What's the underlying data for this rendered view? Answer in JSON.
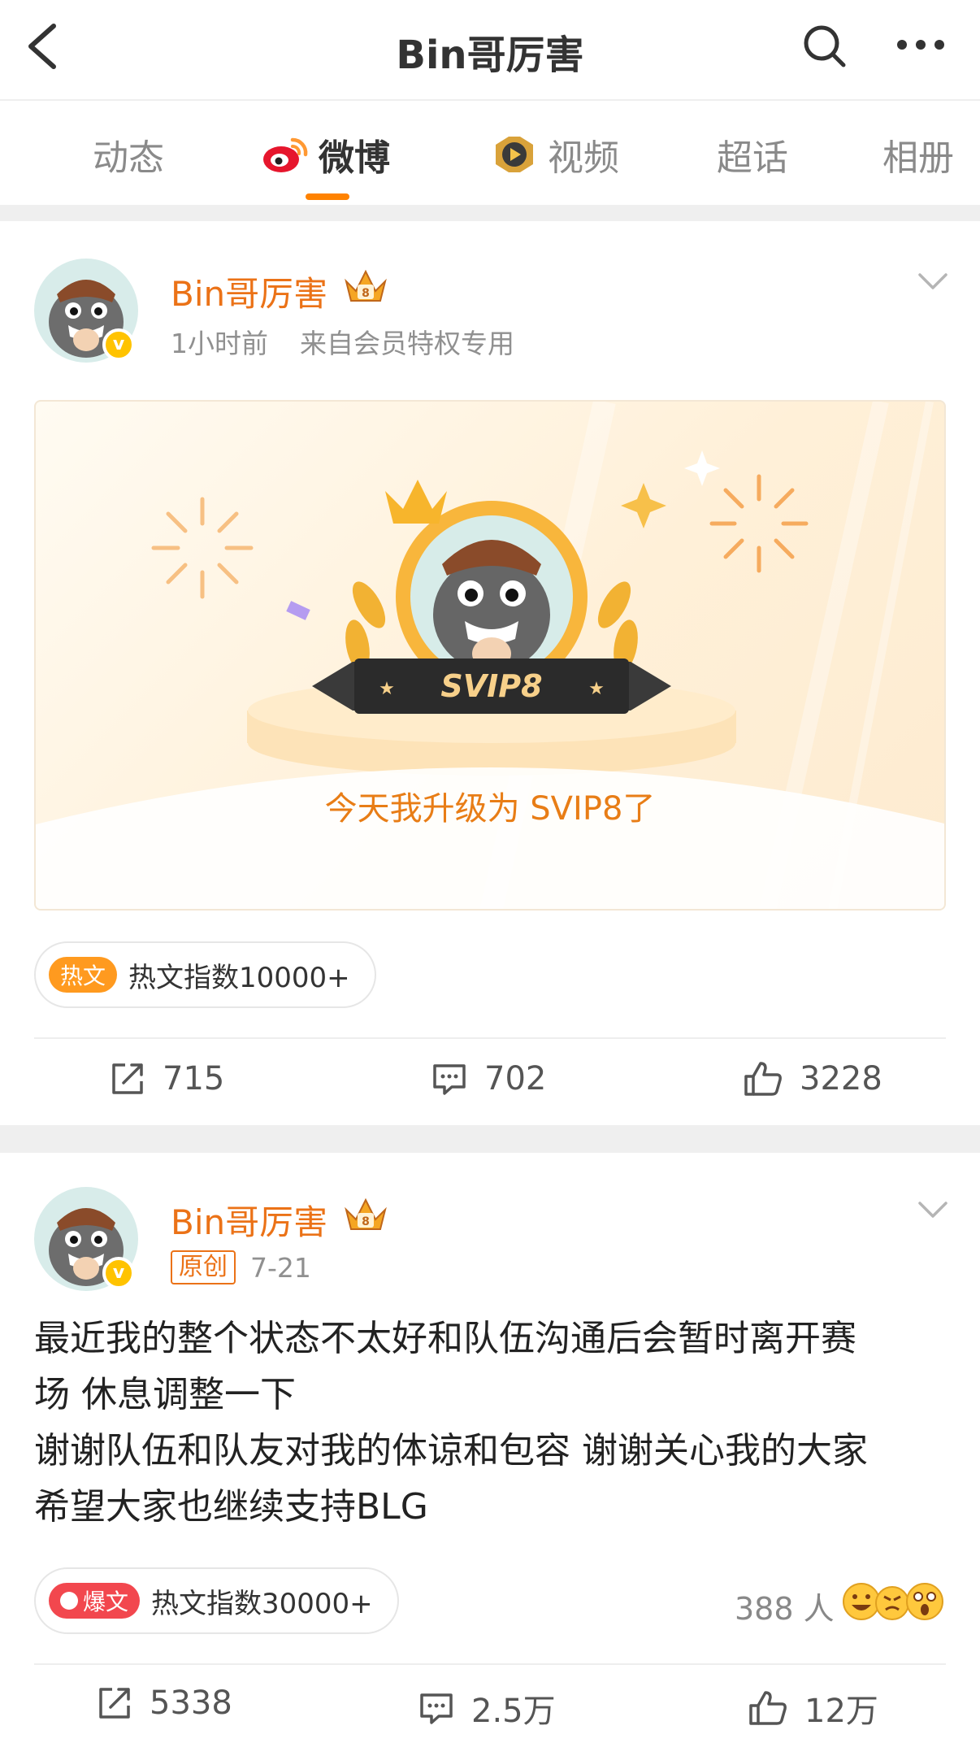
{
  "navbar": {
    "title": "Bin哥厉害"
  },
  "tabs": [
    {
      "label": "动态"
    },
    {
      "label": "微博"
    },
    {
      "label": "视频"
    },
    {
      "label": "超话"
    },
    {
      "label": "相册"
    }
  ],
  "posts": [
    {
      "author": "Bin哥厉害",
      "time": "1小时前",
      "source": "来自会员特权专用",
      "card": {
        "badge_text": "SVIP8",
        "caption": "今天我升级为 SVIP8了"
      },
      "hot": {
        "tag": "热文",
        "text": "热文指数10000+"
      },
      "actions": {
        "reposts": "715",
        "comments": "702",
        "likes": "3228"
      }
    },
    {
      "author": "Bin哥厉害",
      "original_tag": "原创",
      "date": "7-21",
      "body": [
        "最近我的整个状态不太好和队伍沟通后会暂时离开赛",
        "场 休息调整一下",
        "谢谢队伍和队友对我的体谅和包容 谢谢关心我的大家",
        "希望大家也继续支持BLG"
      ],
      "hot": {
        "tag": "爆文",
        "text": "热文指数30000+"
      },
      "reactions": "388 人",
      "actions": {
        "reposts": "5338",
        "comments": "2.5万",
        "likes": "12万"
      }
    }
  ],
  "colors": {
    "accent": "#ff8200",
    "author_name": "#eb7217",
    "hot_tag": "#ff9a1f",
    "explosive_tag": "#f2474e"
  },
  "icons": [
    "back-arrow-icon",
    "search-icon",
    "more-icon",
    "weibo-logo-icon",
    "video-icon",
    "crown-icon",
    "chevron-down-icon",
    "repost-icon",
    "comment-icon",
    "like-icon",
    "verified-icon"
  ]
}
